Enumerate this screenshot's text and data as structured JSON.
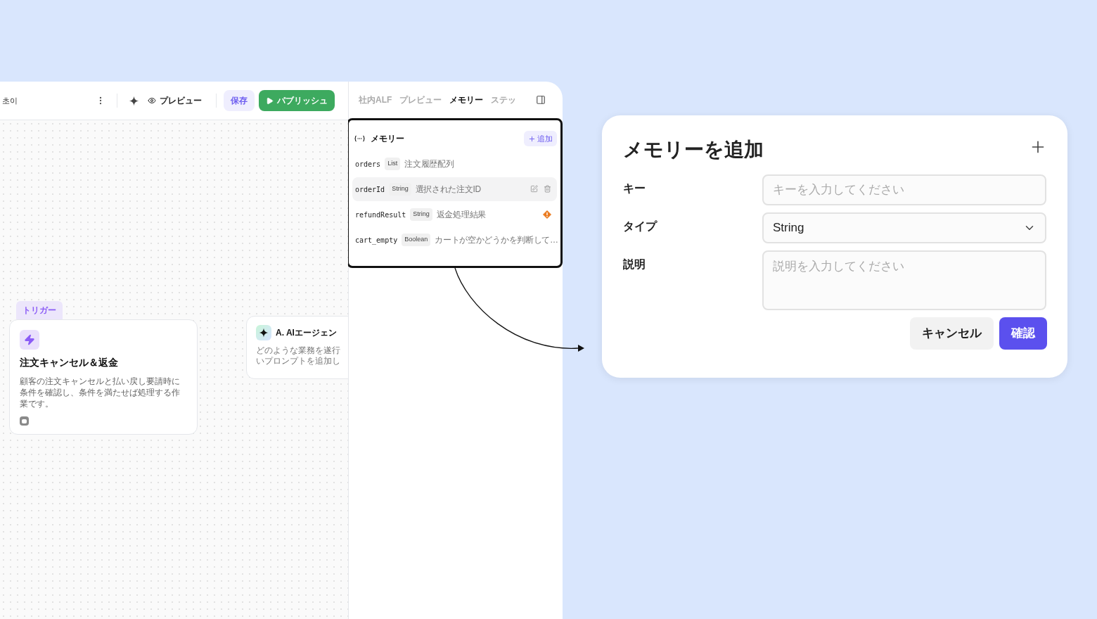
{
  "toolbar": {
    "workspace_name": "초이",
    "preview_label": "プレビュー",
    "save_label": "保存",
    "publish_label": "パブリッシュ"
  },
  "canvas": {
    "nodes": [
      {
        "kind": "trigger",
        "badge": "トリガー",
        "title": "注文キャンセル＆返金",
        "description": "顧客の注文キャンセルと払い戻し要請時に条件を確認し、条件を満たせば処理する作業です。"
      },
      {
        "kind": "agent",
        "title": "A. AIエージェン",
        "description_lines": [
          "どのような業務を遂行",
          "いプロンプトを追加し"
        ]
      }
    ]
  },
  "side_panel": {
    "tabs": [
      {
        "label": "社内ALF",
        "selected": false
      },
      {
        "label": "プレビュー",
        "selected": false
      },
      {
        "label": "メモリー",
        "selected": true
      },
      {
        "label": "ステッ",
        "selected": false
      }
    ],
    "memory": {
      "title": "メモリー",
      "add_label": "追加",
      "items": [
        {
          "key": "orders",
          "type": "List",
          "description": "注文履歴配列",
          "selected": false,
          "warning": false
        },
        {
          "key": "orderId",
          "type": "String",
          "description": "選択された注文ID",
          "selected": true,
          "warning": false
        },
        {
          "key": "refundResult",
          "type": "String",
          "description": "返金処理結果",
          "selected": false,
          "warning": true
        },
        {
          "key": "cart_empty",
          "type": "Boolean",
          "description": "カートが空かどうかを判断して…",
          "selected": false,
          "warning": false
        }
      ]
    }
  },
  "dialog": {
    "title": "メモリーを追加",
    "fields": [
      {
        "kind": "text",
        "label": "キー",
        "placeholder": "キーを入力してください"
      },
      {
        "kind": "select",
        "label": "タイプ",
        "value": "String"
      },
      {
        "kind": "textarea",
        "label": "説明",
        "placeholder": "説明を入力してください"
      }
    ],
    "cancel_label": "キャンセル",
    "confirm_label": "確認"
  }
}
